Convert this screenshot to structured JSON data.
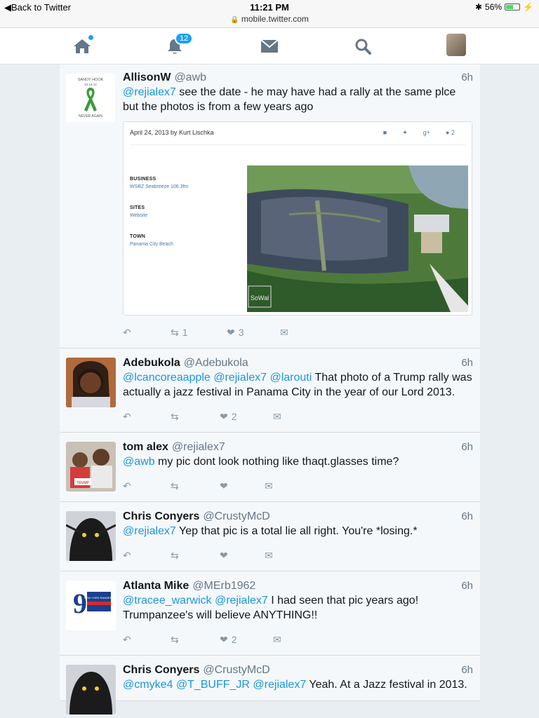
{
  "browser": {
    "back_label": "Back to Twitter",
    "time": "11:21 PM",
    "url": "mobile.twitter.com",
    "battery": "56%"
  },
  "nav": {
    "notifications_badge": "12",
    "brand_color": "#1da1f2"
  },
  "tweets": [
    {
      "name": "AllisonW",
      "handle": "@awb",
      "time": "6h",
      "mention": "@rejialex7",
      "text": " see the date - he may have had a rally at the same plce but the photos is from a few years ago",
      "retweets": "1",
      "likes": "3",
      "avatar": {
        "line1": "SANDY HOOK",
        "line2": "12.14.12",
        "line3": "NEVER AGAIN"
      },
      "card": {
        "date_author": "April 24, 2013 by Kurt Lischka",
        "comment_count": "2",
        "gplus": "g+",
        "business_label": "BUSINESS",
        "business_value": "WSBZ Seabreeze 106.3fm",
        "sites_label": "SITES",
        "sites_value": "Website",
        "town_label": "TOWN",
        "town_value": "Panama City Beach",
        "watermark": "SoWal"
      }
    },
    {
      "name": "Adebukola",
      "handle": "@Adebukola",
      "time": "6h",
      "mentions": "@lcancoreaapple @rejialex7 @larouti",
      "text": " That photo of a Trump rally was actually a jazz festival in Panama City in the year of our Lord 2013.",
      "likes": "2"
    },
    {
      "name": "tom alex",
      "handle": "@rejialex7",
      "time": "6h",
      "mention": "@awb",
      "text": " my pic dont look nothing like thaqt.glasses time?",
      "sign": "TRUMP"
    },
    {
      "name": "Chris Conyers",
      "handle": "@CrustyMcD",
      "time": "6h",
      "mention": "@rejialex7",
      "text": " Yep that pic is a total lie all right. You're *losing.*"
    },
    {
      "name": "Atlanta Mike",
      "handle": "@MErb1962",
      "time": "6h",
      "mentions": "@tracee_warwick @rejialex7",
      "text": " I had seen that pic years ago! Trumpanzee's will believe ANYTHING!!",
      "likes": "2",
      "logo_number": "9",
      "logo_text": "NEW YORK RANGERS"
    },
    {
      "name": "Chris Conyers",
      "handle": "@CrustyMcD",
      "time": "6h",
      "mentions": "@cmyke4 @T_BUFF_JR @rejialex7",
      "text": " Yeah. At a Jazz festival in 2013."
    }
  ]
}
